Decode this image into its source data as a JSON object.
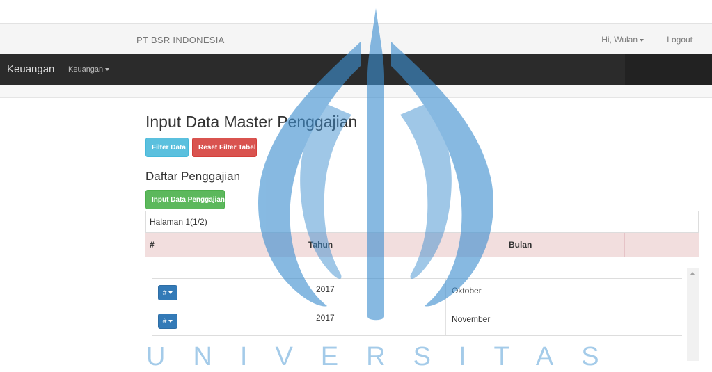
{
  "header": {
    "brand": "PT BSR INDONESIA",
    "user_greeting": "Hi, Wulan",
    "logout": "Logout"
  },
  "navbar": {
    "brand": "Keuangan",
    "menu": "Keuangan"
  },
  "main": {
    "title": "Input Data Master Penggajian",
    "filter_button": "Filter Data",
    "reset_button": "Reset Filter Tabel",
    "list_title": "Daftar Penggajian",
    "input_button": "Input Data Penggajian",
    "pagination": "Halaman 1(1/2)"
  },
  "table": {
    "columns": [
      "#",
      "Tahun",
      "Bulan"
    ],
    "rows": [
      {
        "action": "#",
        "year": "2017",
        "month": "Oktober"
      },
      {
        "action": "#",
        "year": "2017",
        "month": "November"
      }
    ]
  },
  "watermark": {
    "text": "UNIVERSITAS",
    "color": "#3e8fd0"
  },
  "colors": {
    "info": "#5bc0de",
    "danger": "#d9534f",
    "success": "#5cb85c",
    "primary": "#337ab7",
    "table_header": "#f2dede",
    "navbar": "#222222"
  }
}
